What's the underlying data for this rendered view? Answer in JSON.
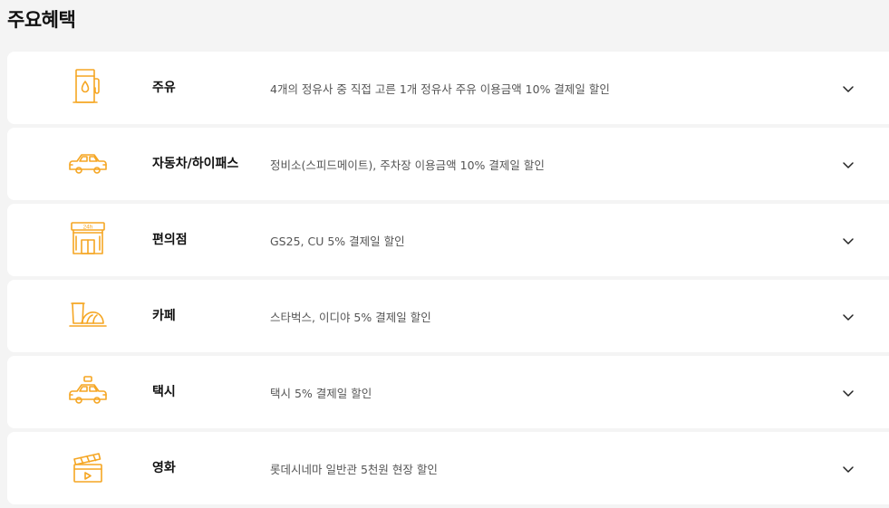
{
  "page": {
    "title": "주요혜택"
  },
  "colors": {
    "accent": "#f5a623",
    "background": "#f4f4f4",
    "card": "#ffffff",
    "description_text": "#555555"
  },
  "benefits": [
    {
      "name": "주유",
      "description": "4개의 정유사 중 직접 고른 1개 정유사 주유 이용금액 10% 결제일 할인",
      "icon": "gas-station-icon"
    },
    {
      "name": "자동차/하이패스",
      "description": "정비소(스피드메이트), 주차장 이용금액 10% 결제일 할인",
      "icon": "car-icon"
    },
    {
      "name": "편의점",
      "description": "GS25, CU 5% 결제일 할인",
      "icon": "convenience-store-icon",
      "store_sign": "24h"
    },
    {
      "name": "카페",
      "description": "스타벅스, 이디야 5% 결제일 할인",
      "icon": "coffee-croissant-icon"
    },
    {
      "name": "택시",
      "description": "택시 5% 결제일 할인",
      "icon": "taxi-icon"
    },
    {
      "name": "영화",
      "description": "롯데시네마 일반관 5천원 현장 할인",
      "icon": "clapperboard-icon"
    }
  ]
}
